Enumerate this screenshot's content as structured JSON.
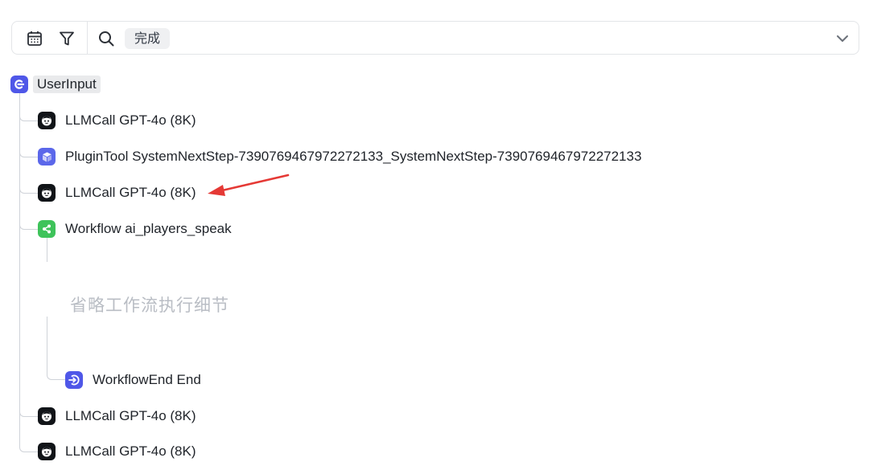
{
  "toolbar": {
    "status_tag": "完成"
  },
  "icons": {
    "calendar": "calendar-icon",
    "filter": "filter-icon",
    "search": "search-icon",
    "chevron": "chevron-down-icon"
  },
  "colors": {
    "user_input_icon": "#4f57e8",
    "llm_icon": "#111418",
    "plugin_icon": "#5b67ea",
    "workflow_icon": "#3ec35a",
    "annotation_arrow": "#e53935",
    "tree_line": "#cfd3d9"
  },
  "tree": {
    "root_label": "UserInput",
    "nodes": [
      {
        "type": "LLMCall",
        "label": "LLMCall GPT-4o (8K)"
      },
      {
        "type": "PluginTool",
        "label": "PluginTool SystemNextStep-7390769467972272133_SystemNextStep-7390769467972272133"
      },
      {
        "type": "LLMCall",
        "label": "LLMCall GPT-4o (8K)"
      },
      {
        "type": "Workflow",
        "label": "Workflow ai_players_speak",
        "omitted_note": "省略工作流执行细节",
        "children": [
          {
            "type": "WorkflowEnd",
            "label": "WorkflowEnd End"
          }
        ]
      },
      {
        "type": "LLMCall",
        "label": "LLMCall GPT-4o (8K)"
      },
      {
        "type": "LLMCall",
        "label": "LLMCall GPT-4o (8K)"
      }
    ]
  }
}
